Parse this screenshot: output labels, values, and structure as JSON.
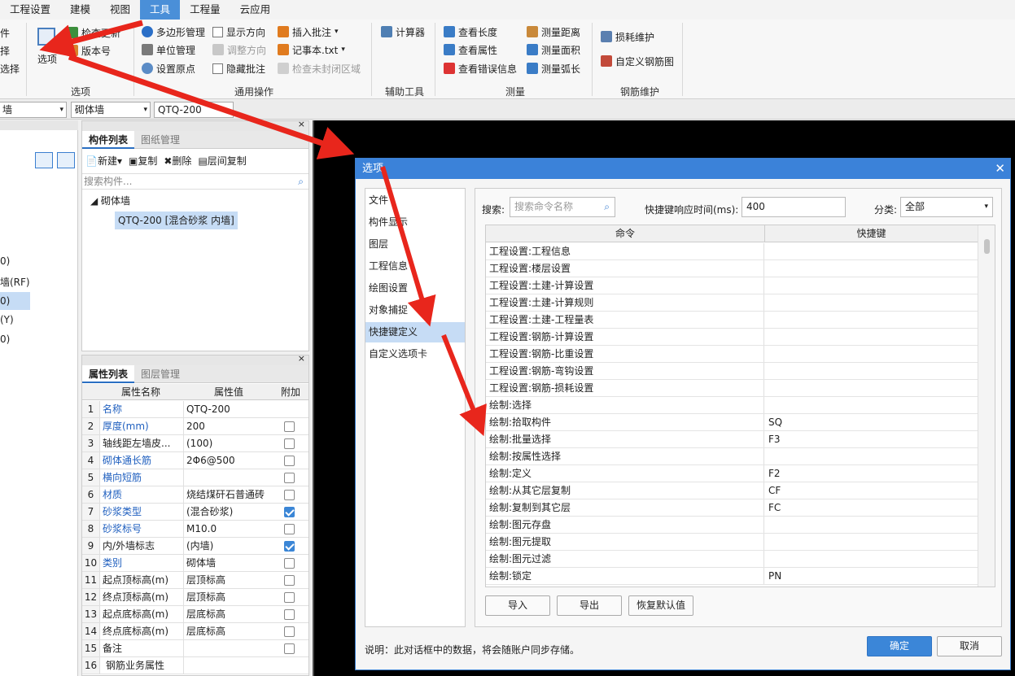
{
  "menu": [
    "工程设置",
    "建模",
    "视图",
    "工具",
    "工程量",
    "云应用"
  ],
  "menu_active": "工具",
  "ribbon": {
    "options_group": {
      "left_partial": [
        "件",
        "择",
        "选择"
      ],
      "big_button": "选项",
      "small_buttons": [
        "检查更新",
        "版本号"
      ],
      "group_label": "选项"
    },
    "general_ops": {
      "col1": [
        "多边形管理",
        "单位管理",
        "设置原点"
      ],
      "col2": [
        "显示方向",
        "调整方向",
        "隐藏批注"
      ],
      "col3": [
        "插入批注",
        "记事本.txt",
        "检查未封闭区域"
      ],
      "group_label": "通用操作"
    },
    "aux_tools": {
      "items": [
        "计算器"
      ],
      "group_label": "辅助工具"
    },
    "measure": {
      "col1": [
        "查看长度",
        "查看属性",
        "查看错误信息"
      ],
      "col2": [
        "测量距离",
        "测量面积",
        "测量弧长"
      ],
      "group_label": "测量"
    },
    "rebar": {
      "items": [
        "损耗维护",
        "自定义钢筋图"
      ],
      "group_label": "钢筋维护"
    }
  },
  "toolbar_row": {
    "combo1": "墙",
    "combo2": "砌体墙",
    "combo3": "QTQ-200"
  },
  "left_tree": [
    "0)",
    "墙(RF)",
    "0)",
    "(Y)",
    "0)"
  ],
  "comp_panel": {
    "tabs": [
      "构件列表",
      "图纸管理"
    ],
    "actions": [
      "新建",
      "复制",
      "删除",
      "层间复制"
    ],
    "search_placeholder": "搜索构件...",
    "tree_root": "砌体墙",
    "tree_child": "QTQ-200 [混合砂浆 内墙]"
  },
  "prop_panel": {
    "tabs": [
      "属性列表",
      "图层管理"
    ],
    "headers": [
      "属性名称",
      "属性值",
      "附加"
    ],
    "rows": [
      {
        "n": "1",
        "k": "名称",
        "v": "QTQ-200",
        "blue": true,
        "cb": null
      },
      {
        "n": "2",
        "k": "厚度(mm)",
        "v": "200",
        "blue": true,
        "cb": false
      },
      {
        "n": "3",
        "k": "轴线距左墙皮...",
        "v": "(100)",
        "blue": false,
        "cb": false
      },
      {
        "n": "4",
        "k": "砌体通长筋",
        "v": "2Φ6@500",
        "blue": true,
        "cb": false
      },
      {
        "n": "5",
        "k": "横向短筋",
        "v": "",
        "blue": true,
        "cb": false
      },
      {
        "n": "6",
        "k": "材质",
        "v": "烧结煤矸石普通砖",
        "blue": true,
        "cb": false
      },
      {
        "n": "7",
        "k": "砂浆类型",
        "v": "(混合砂浆)",
        "blue": true,
        "cb": true
      },
      {
        "n": "8",
        "k": "砂浆标号",
        "v": "M10.0",
        "blue": true,
        "cb": false
      },
      {
        "n": "9",
        "k": "内/外墙标志",
        "v": "(内墙)",
        "blue": false,
        "cb": true
      },
      {
        "n": "10",
        "k": "类别",
        "v": "砌体墙",
        "blue": true,
        "cb": false
      },
      {
        "n": "11",
        "k": "起点顶标高(m)",
        "v": "层顶标高",
        "blue": false,
        "cb": false
      },
      {
        "n": "12",
        "k": "终点顶标高(m)",
        "v": "层顶标高",
        "blue": false,
        "cb": false
      },
      {
        "n": "13",
        "k": "起点底标高(m)",
        "v": "层底标高",
        "blue": false,
        "cb": false
      },
      {
        "n": "14",
        "k": "终点底标高(m)",
        "v": "层底标高",
        "blue": false,
        "cb": false
      },
      {
        "n": "15",
        "k": "备注",
        "v": "",
        "blue": false,
        "cb": false
      },
      {
        "n": "16",
        "k": "钢筋业务属性",
        "v": "",
        "blue": false,
        "cb": null
      }
    ]
  },
  "dialog": {
    "title": "选项",
    "nav": [
      "文件",
      "构件显示",
      "图层",
      "工程信息",
      "绘图设置",
      "对象捕捉",
      "快捷键定义",
      "自定义选项卡"
    ],
    "nav_selected": "快捷键定义",
    "search_label": "搜索:",
    "search_placeholder": "搜索命令名称",
    "delay_label": "快捷键响应时间(ms):",
    "delay_value": "400",
    "category_label": "分类:",
    "category_value": "全部",
    "grid_headers": [
      "命令",
      "快捷键"
    ],
    "rows": [
      {
        "cmd": "工程设置:工程信息",
        "key": ""
      },
      {
        "cmd": "工程设置:楼层设置",
        "key": ""
      },
      {
        "cmd": "工程设置:土建-计算设置",
        "key": ""
      },
      {
        "cmd": "工程设置:土建-计算规则",
        "key": ""
      },
      {
        "cmd": "工程设置:土建-工程量表",
        "key": ""
      },
      {
        "cmd": "工程设置:钢筋-计算设置",
        "key": ""
      },
      {
        "cmd": "工程设置:钢筋-比重设置",
        "key": ""
      },
      {
        "cmd": "工程设置:钢筋-弯钩设置",
        "key": ""
      },
      {
        "cmd": "工程设置:钢筋-损耗设置",
        "key": ""
      },
      {
        "cmd": "绘制:选择",
        "key": ""
      },
      {
        "cmd": "绘制:拾取构件",
        "key": "SQ"
      },
      {
        "cmd": "绘制:批量选择",
        "key": "F3"
      },
      {
        "cmd": "绘制:按属性选择",
        "key": ""
      },
      {
        "cmd": "绘制:定义",
        "key": "F2"
      },
      {
        "cmd": "绘制:从其它层复制",
        "key": "CF"
      },
      {
        "cmd": "绘制:复制到其它层",
        "key": "FC"
      },
      {
        "cmd": "绘制:图元存盘",
        "key": ""
      },
      {
        "cmd": "绘制:图元提取",
        "key": ""
      },
      {
        "cmd": "绘制:图元过滤",
        "key": ""
      },
      {
        "cmd": "绘制:锁定",
        "key": "PN"
      }
    ],
    "buttons": [
      "导入",
      "导出",
      "恢复默认值"
    ],
    "note": "说明：此对话框中的数据，将会随账户同步存储。",
    "ok": "确定",
    "cancel": "取消"
  },
  "colors": {
    "accent": "#3b82d9",
    "arrow": "#e8261c",
    "canvas": "#000000"
  }
}
